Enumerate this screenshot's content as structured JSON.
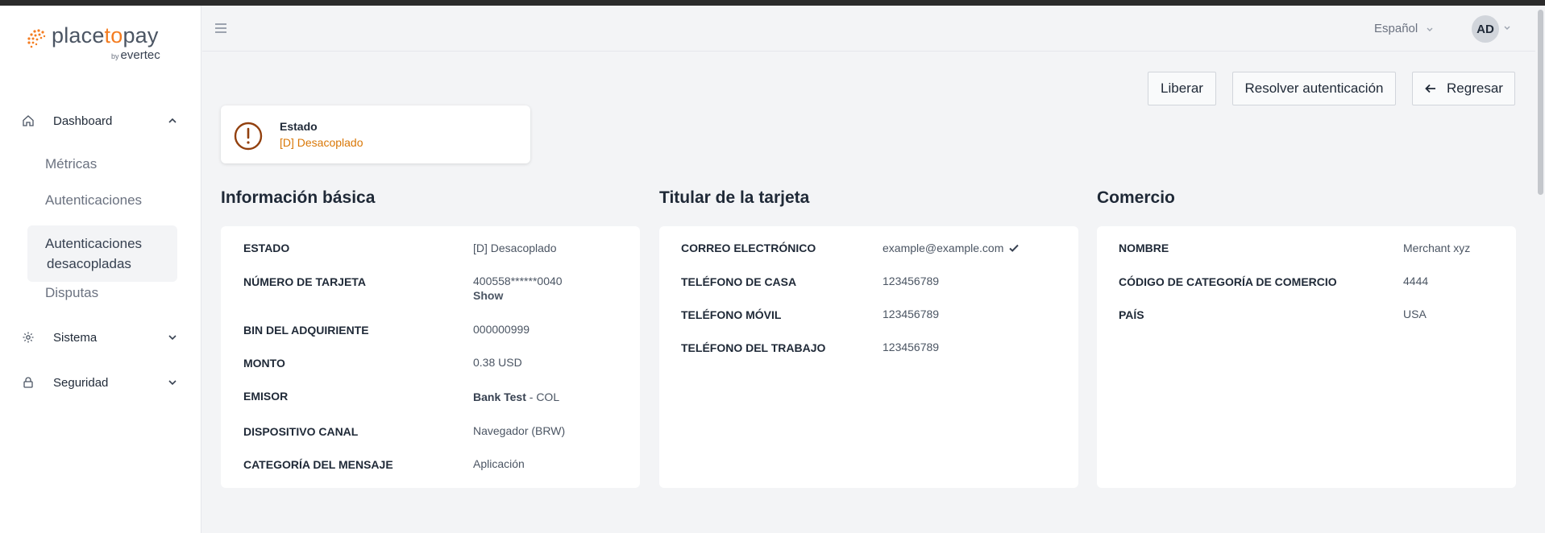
{
  "brand": {
    "logo_main_part1": "place",
    "logo_main_accent": "to",
    "logo_main_part2": "pay",
    "logo_by": "by",
    "logo_sub": "evertec"
  },
  "sidebar": {
    "dashboard_label": "Dashboard",
    "dashboard_items": [
      "Métricas",
      "Autenticaciones",
      "Autenticaciones desacopladas",
      "Disputas"
    ],
    "sistema_label": "Sistema",
    "seguridad_label": "Seguridad"
  },
  "header": {
    "language": "Español",
    "avatar_initials": "AD"
  },
  "actions": {
    "liberar": "Liberar",
    "resolver": "Resolver autenticación",
    "regresar": "Regresar"
  },
  "status": {
    "title": "Estado",
    "value": "[D] Desacoplado",
    "value_color": "#d97706"
  },
  "basic_info": {
    "title": "Información básica",
    "rows": [
      {
        "label": "ESTADO",
        "value": "[D] Desacoplado"
      },
      {
        "label": "NÚMERO DE TARJETA",
        "value": "400558******0040",
        "link": "Show"
      },
      {
        "label": "BIN DEL ADQUIRIENTE",
        "value": "000000999"
      },
      {
        "label": "MONTO",
        "value": "0.38 USD"
      },
      {
        "label": "EMISOR",
        "value_bold": "Bank Test",
        "value": " - COL"
      },
      {
        "label": "DISPOSITIVO CANAL",
        "value": "Navegador (BRW)"
      },
      {
        "label": "CATEGORÍA DEL MENSAJE",
        "value": "Aplicación"
      }
    ]
  },
  "cardholder": {
    "title": "Titular de la tarjeta",
    "rows": [
      {
        "label": "CORREO ELECTRÓNICO",
        "value": "example@example.com"
      },
      {
        "label": "TELÉFONO DE CASA",
        "value": "123456789"
      },
      {
        "label": "TELÉFONO MÓVIL",
        "value": "123456789"
      },
      {
        "label": "TELÉFONO DEL TRABAJO",
        "value": "123456789"
      }
    ]
  },
  "merchant": {
    "title": "Comercio",
    "rows": [
      {
        "label": "NOMBRE",
        "value": "Merchant xyz"
      },
      {
        "label": "CÓDIGO DE CATEGORÍA DE COMERCIO",
        "value": "4444"
      },
      {
        "label": "PAÍS",
        "value": "USA"
      }
    ]
  }
}
